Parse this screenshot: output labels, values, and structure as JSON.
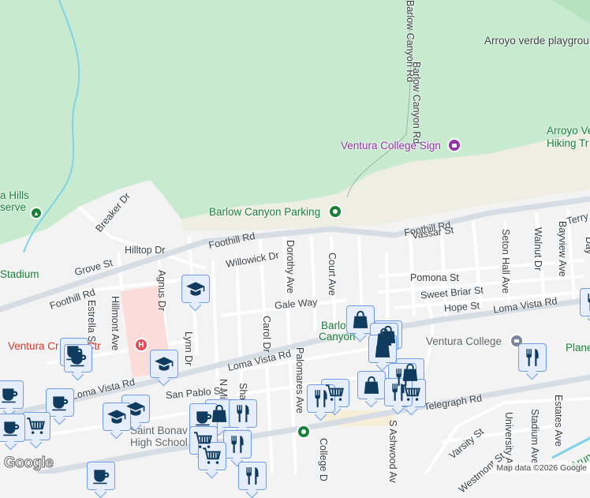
{
  "colors": {
    "park": "#c8ebd0",
    "sand": "#efeee3",
    "road": "#ffffff",
    "major_road": "#d6dde5",
    "marker_fill": "#e6eefc",
    "marker_border": "#6f9be6",
    "icon": "#0f3b5e",
    "hospital": "#e34b59"
  },
  "places": {
    "arroyo_playground": "Arroyo verde playground",
    "college_sign": "Ventura College Sign",
    "hiking_trail_1": "Arroyo Ve",
    "hiking_trail_2": "Hiking Tr",
    "barlow_parking": "Barlow Canyon Parking",
    "hills_reserve_1": "a Hills",
    "hills_reserve_2": "serve",
    "stadium": "Stadium",
    "medical_ctr": "Ventura Cr      dical Ctr",
    "saint_bonaventure_1": "Saint Bonav",
    "saint_bonaventure_2": "High School",
    "barlow_canyon_1": "Barlo",
    "barlow_canyon_2": "Canyon",
    "ventura_college": "Ventura College",
    "planetarium": "Plane"
  },
  "roads": {
    "barlow_canyon_rd_top": "Barlow Canyon Rd",
    "barlow_canyon_rd": "Barlow Canyon Rd",
    "breaker_dr": "Breaker Dr",
    "hilltop_dr": "Hilltop Dr",
    "grove_st": "Grove St",
    "foothill_rd_1": "Foothill Rd",
    "foothill_rd_2": "Foothill Rd",
    "foothill_rd_3": "Foothill Rd",
    "willowick_dr": "Willowick Dr",
    "dorothy_ave": "Dorothy Ave",
    "court_ave": "Court Ave",
    "vassar_st": "Vassar St",
    "pomona_st": "Pomona St",
    "sweet_briar_st": "Sweet Briar St",
    "hope_st": "Hope St",
    "gale_way": "Gale Way",
    "loma_vista_rd_1": "Loma Vista Rd",
    "loma_vista_rd_2": "Loma Vista Rd",
    "loma_vista_rd_3": "Loma Vista Rd",
    "carol_dr": "Carol Dr",
    "palomares_ave": "Palomares Ave",
    "agnus_dr": "Agnus Dr",
    "hillmont_ave": "Hillmont Ave",
    "estrella_st": "Estrella St",
    "lynn_dr": "Lynn Dr",
    "san_pablo_st": "San Pablo St",
    "n_mi": "N Mi",
    "shar": "Shar",
    "telegraph_rd": "Telegraph Rd",
    "college_dr": "College D",
    "s_ashwood_ave": "S Ashwood Av",
    "varsity_st": "Varsity St",
    "westmont_st": "Westmont St",
    "university_ave": "University Av",
    "stadium_ave": "Stadium Ave",
    "estates_ave": "Estates Ave",
    "seton_hall_ave": "Seton Hall Ave",
    "walnut_dr": "Walnut Dr",
    "bayview_ave": "Bayview Ave",
    "terry_dr": "Terry Dr",
    "day": "Day",
    "arundell": "Arund"
  },
  "attribution": {
    "logo": "Google",
    "map_data": "Map data ©2026 Google"
  }
}
